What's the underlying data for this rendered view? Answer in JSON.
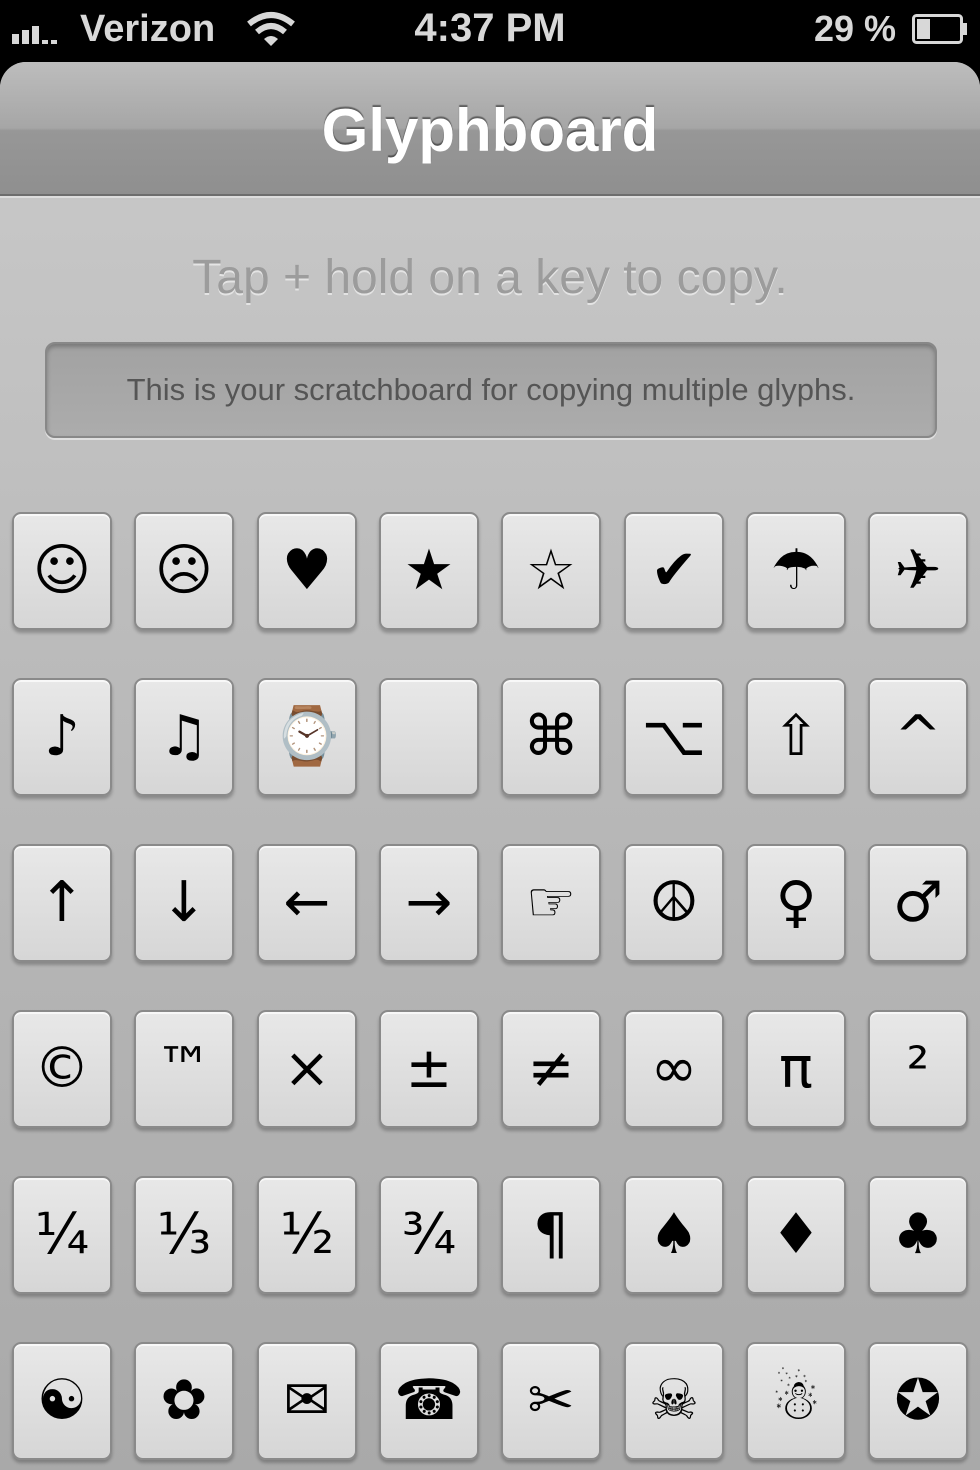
{
  "status_bar": {
    "carrier": "Verizon",
    "time": "4:37 PM",
    "battery_percent": "29 %"
  },
  "nav": {
    "title": "Glyphboard"
  },
  "hint": "Tap + hold on a key to copy.",
  "scratchboard": {
    "placeholder": "This is your scratchboard for copying multiple glyphs."
  },
  "rows": [
    [
      {
        "glyph": "☺",
        "name": "smiley-face-icon"
      },
      {
        "glyph": "☹",
        "name": "frowning-face-icon"
      },
      {
        "glyph": "♥",
        "name": "heart-icon"
      },
      {
        "glyph": "★",
        "name": "black-star-icon"
      },
      {
        "glyph": "☆",
        "name": "white-star-icon"
      },
      {
        "glyph": "✔",
        "name": "check-mark-icon"
      },
      {
        "glyph": "☂",
        "name": "umbrella-icon"
      },
      {
        "glyph": "✈",
        "name": "airplane-icon"
      }
    ],
    [
      {
        "glyph": "♪",
        "name": "eighth-note-icon"
      },
      {
        "glyph": "♫",
        "name": "beamed-notes-icon"
      },
      {
        "glyph": "⌚",
        "name": "watch-icon"
      },
      {
        "glyph": "",
        "name": "apple-logo-icon"
      },
      {
        "glyph": "⌘",
        "name": "command-key-icon"
      },
      {
        "glyph": "⌥",
        "name": "option-key-icon"
      },
      {
        "glyph": "⇧",
        "name": "shift-arrow-icon"
      },
      {
        "glyph": "^",
        "name": "caret-icon"
      }
    ],
    [
      {
        "glyph": "↑",
        "name": "up-arrow-icon"
      },
      {
        "glyph": "↓",
        "name": "down-arrow-icon"
      },
      {
        "glyph": "←",
        "name": "left-arrow-icon"
      },
      {
        "glyph": "→",
        "name": "right-arrow-icon"
      },
      {
        "glyph": "☞",
        "name": "pointing-hand-icon"
      },
      {
        "glyph": "☮",
        "name": "peace-sign-icon"
      },
      {
        "glyph": "♀",
        "name": "female-sign-icon"
      },
      {
        "glyph": "♂",
        "name": "male-sign-icon"
      }
    ],
    [
      {
        "glyph": "©",
        "name": "copyright-icon"
      },
      {
        "glyph": "™",
        "name": "trademark-icon"
      },
      {
        "glyph": "×",
        "name": "multiplication-icon"
      },
      {
        "glyph": "±",
        "name": "plus-minus-icon"
      },
      {
        "glyph": "≠",
        "name": "not-equal-icon"
      },
      {
        "glyph": "∞",
        "name": "infinity-icon"
      },
      {
        "glyph": "π",
        "name": "pi-icon"
      },
      {
        "glyph": "²",
        "name": "superscript-two-icon"
      }
    ],
    [
      {
        "glyph": "¼",
        "name": "one-quarter-icon"
      },
      {
        "glyph": "⅓",
        "name": "one-third-icon"
      },
      {
        "glyph": "½",
        "name": "one-half-icon"
      },
      {
        "glyph": "¾",
        "name": "three-quarters-icon"
      },
      {
        "glyph": "¶",
        "name": "pilcrow-icon"
      },
      {
        "glyph": "♠",
        "name": "spade-icon"
      },
      {
        "glyph": "♦",
        "name": "diamond-icon"
      },
      {
        "glyph": "♣",
        "name": "club-icon"
      }
    ],
    [
      {
        "glyph": "☯",
        "name": "yin-yang-icon"
      },
      {
        "glyph": "✿",
        "name": "flower-icon"
      },
      {
        "glyph": "✉",
        "name": "envelope-icon"
      },
      {
        "glyph": "☎",
        "name": "telephone-icon"
      },
      {
        "glyph": "✂",
        "name": "scissors-icon"
      },
      {
        "glyph": "☠",
        "name": "skull-crossbones-icon"
      },
      {
        "glyph": "☃",
        "name": "snowman-icon"
      },
      {
        "glyph": "✪",
        "name": "circled-star-icon"
      }
    ]
  ]
}
